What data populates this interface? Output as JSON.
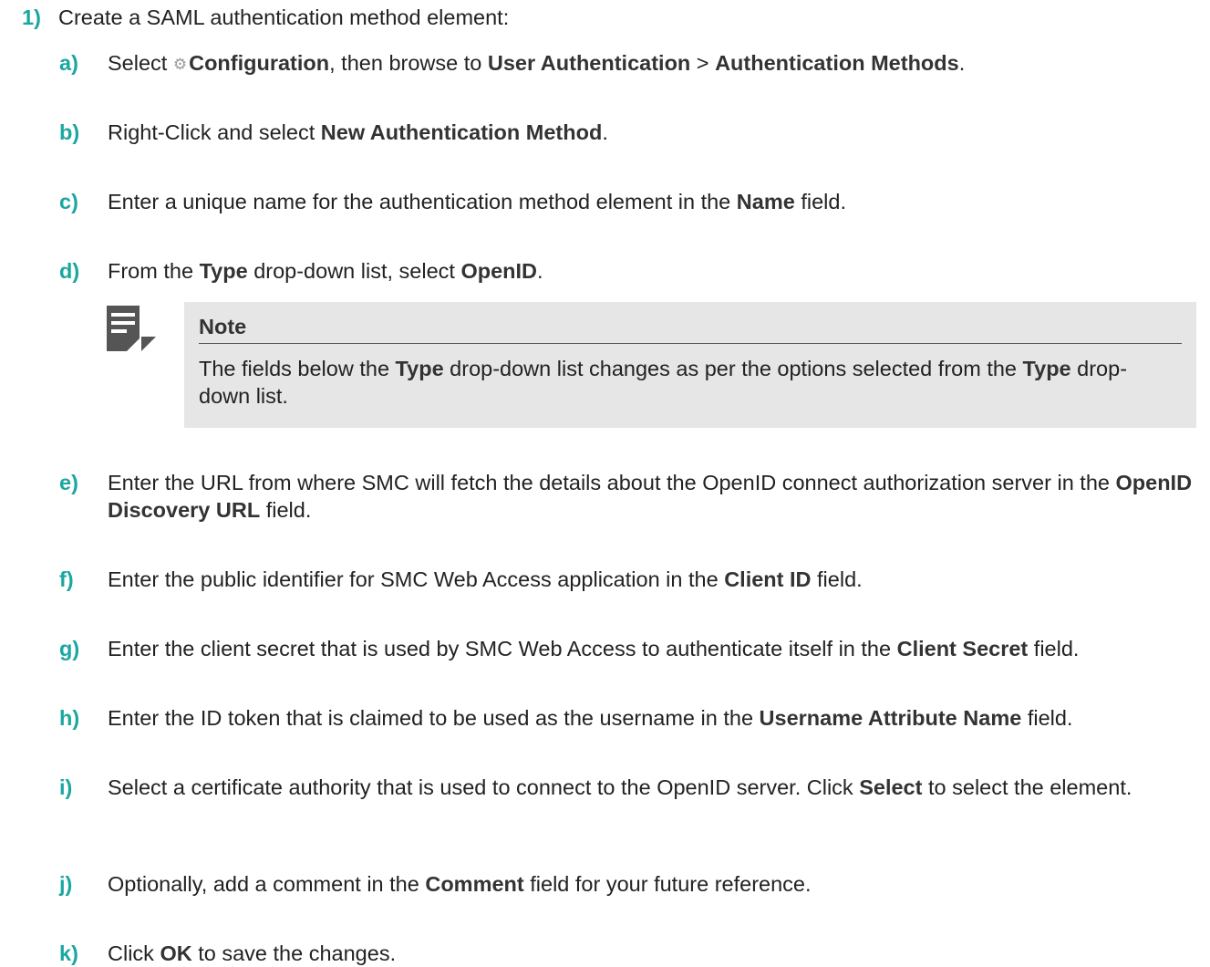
{
  "step": {
    "number": "1)",
    "text": "Create a SAML authentication method element:"
  },
  "substeps": {
    "a": {
      "letter": "a)",
      "t1": "Select ",
      "gear_icon": "gear-icon",
      "b1": "Configuration",
      "t2": ", then browse to ",
      "b2": "User Authentication",
      "t3": " > ",
      "b3": "Authentication Methods",
      "t4": "."
    },
    "b": {
      "letter": "b)",
      "t1": "Right-Click and select ",
      "b1": "New Authentication Method",
      "t2": "."
    },
    "c": {
      "letter": "c)",
      "t1": "Enter a unique name for the authentication method element in the ",
      "b1": "Name",
      "t2": " field."
    },
    "d": {
      "letter": "d)",
      "t1": "From the ",
      "b1": "Type",
      "t2": " drop-down list, select ",
      "b2": "OpenID",
      "t3": "."
    },
    "e": {
      "letter": "e)",
      "t1": "Enter the URL from where SMC will fetch the details about the OpenID connect authorization server in the ",
      "b1": "OpenID Discovery URL",
      "t2": " field."
    },
    "f": {
      "letter": "f)",
      "t1": "Enter the public identifier for SMC Web Access application in the ",
      "b1": "Client ID",
      "t2": " field."
    },
    "g": {
      "letter": "g)",
      "t1": "Enter the client secret that is used by SMC Web Access to authenticate itself in the ",
      "b1": "Client Secret",
      "t2": " field."
    },
    "h": {
      "letter": "h)",
      "t1": "Enter the ID token that is claimed to be used as the username in the ",
      "b1": "Username Attribute Name",
      "t2": " field."
    },
    "i": {
      "letter": "i)",
      "t1": "Select a certificate authority that is used to connect to the OpenID server. Click ",
      "b1": "Select",
      "t2": " to select the element."
    },
    "j": {
      "letter": "j)",
      "t1": "Optionally, add a comment in the ",
      "b1": "Comment",
      "t2": " field for your future reference."
    },
    "k": {
      "letter": "k)",
      "t1": "Click ",
      "b1": "OK",
      "t2": " to save the changes."
    }
  },
  "note": {
    "icon": "note-icon",
    "title": "Note",
    "t1": "The fields below the ",
    "b1": "Type",
    "t2": " drop-down list changes as per the options selected from the ",
    "b2": "Type",
    "t3": " drop-down list."
  },
  "colors": {
    "accent": "#1aa7a0",
    "note_background": "#e6e6e6",
    "icon": "#555555"
  }
}
